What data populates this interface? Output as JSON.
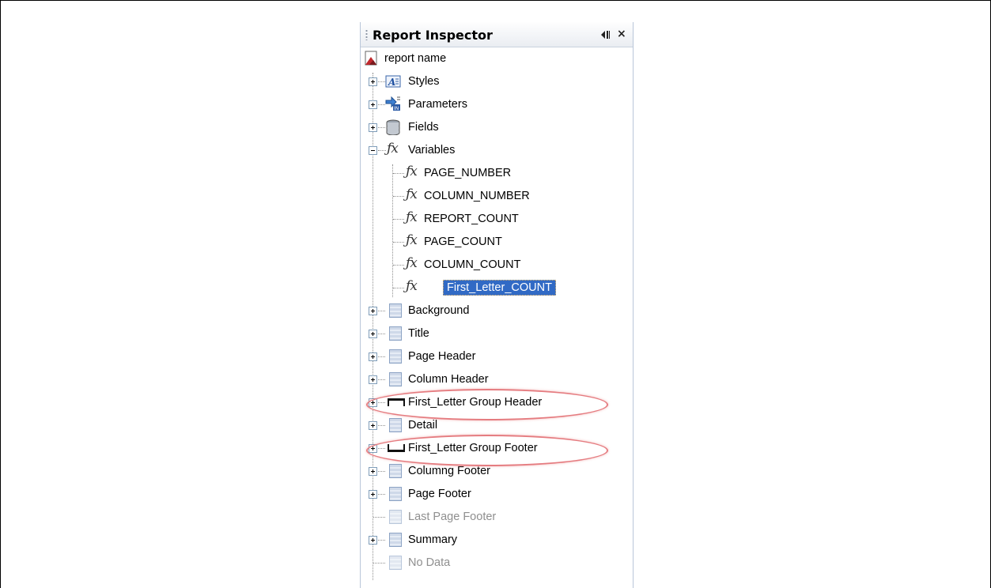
{
  "panel": {
    "title": "Report Inspector",
    "close_symbol": "×"
  },
  "tree": {
    "root": {
      "label": "report name",
      "icon": "report-icon"
    },
    "items": [
      {
        "label": "Styles",
        "icon": "styles-icon",
        "expanded": false
      },
      {
        "label": "Parameters",
        "icon": "parameters-icon",
        "expanded": false
      },
      {
        "label": "Fields",
        "icon": "fields-icon",
        "expanded": false
      },
      {
        "label": "Variables",
        "icon": "fx-icon",
        "expanded": true
      }
    ],
    "variables": [
      {
        "label": "PAGE_NUMBER"
      },
      {
        "label": "COLUMN_NUMBER"
      },
      {
        "label": "REPORT_COUNT"
      },
      {
        "label": "PAGE_COUNT"
      },
      {
        "label": "COLUMN_COUNT"
      },
      {
        "label": "First_Letter_COUNT",
        "selected": true
      }
    ],
    "bands": [
      {
        "label": "Background",
        "icon": "band-icon"
      },
      {
        "label": "Title",
        "icon": "band-icon"
      },
      {
        "label": "Page Header",
        "icon": "band-icon"
      },
      {
        "label": "Column Header",
        "icon": "band-icon"
      },
      {
        "label": "First_Letter Group Header",
        "icon": "group-header-icon",
        "highlighted": true
      },
      {
        "label": "Detail",
        "icon": "band-icon"
      },
      {
        "label": "First_Letter Group Footer",
        "icon": "group-footer-icon",
        "highlighted": true
      },
      {
        "label": "Columng Footer",
        "icon": "band-icon"
      },
      {
        "label": "Page Footer",
        "icon": "band-icon"
      },
      {
        "label": "Last Page Footer",
        "icon": "band-icon",
        "disabled": true
      },
      {
        "label": "Summary",
        "icon": "band-icon"
      },
      {
        "label": "No Data",
        "icon": "band-icon",
        "disabled": true
      }
    ]
  },
  "colors": {
    "selection": "#316ac5",
    "highlight_ellipse": "#e57c80"
  }
}
